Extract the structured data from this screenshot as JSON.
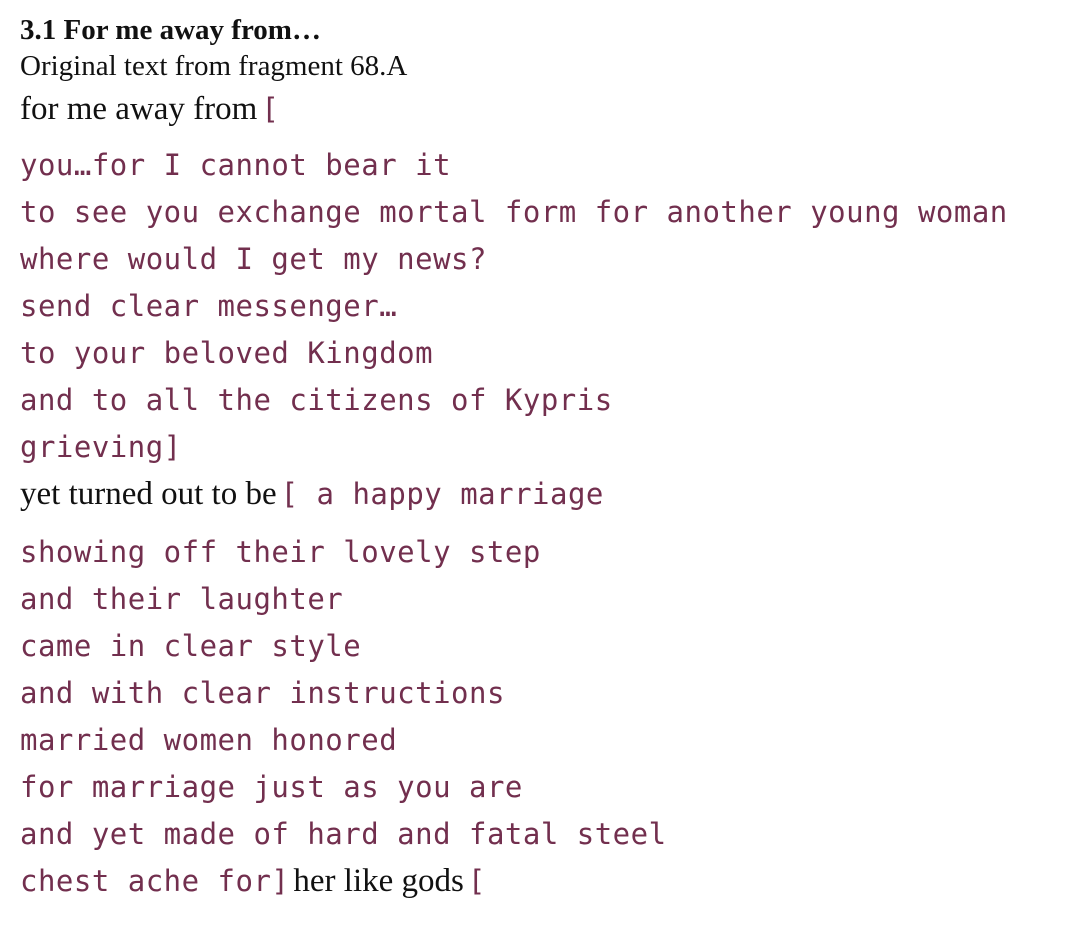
{
  "section": {
    "title": "3.1 For me away from…",
    "subtitle": "Original text from fragment 68.A"
  },
  "colors": {
    "text": "#111111",
    "bracket_text": "#722f4e",
    "background": "#ffffff"
  },
  "poem": {
    "l0": {
      "serif": "for me away from",
      "mono": "["
    },
    "l1": "you…for I cannot bear it",
    "l2": "to see you exchange mortal form for another young woman",
    "l3": "where would I get my news?",
    "l4": "send clear messenger…",
    "l5": "to your beloved Kingdom",
    "l6": "and to all the citizens of Kypris",
    "l7": "grieving]",
    "l8": {
      "serif": "yet turned out to be",
      "mono": "[ a happy marriage"
    },
    "l9": "showing off their lovely step",
    "l10": "and their laughter",
    "l11": "came in clear style",
    "l12": "and with clear instructions",
    "l13": "married women honored",
    "l14": "for marriage just as you are",
    "l15": "and yet made of hard and fatal steel",
    "l16": {
      "mono": "chest ache for]",
      "serif": "her like gods",
      "mono_end": "["
    }
  }
}
